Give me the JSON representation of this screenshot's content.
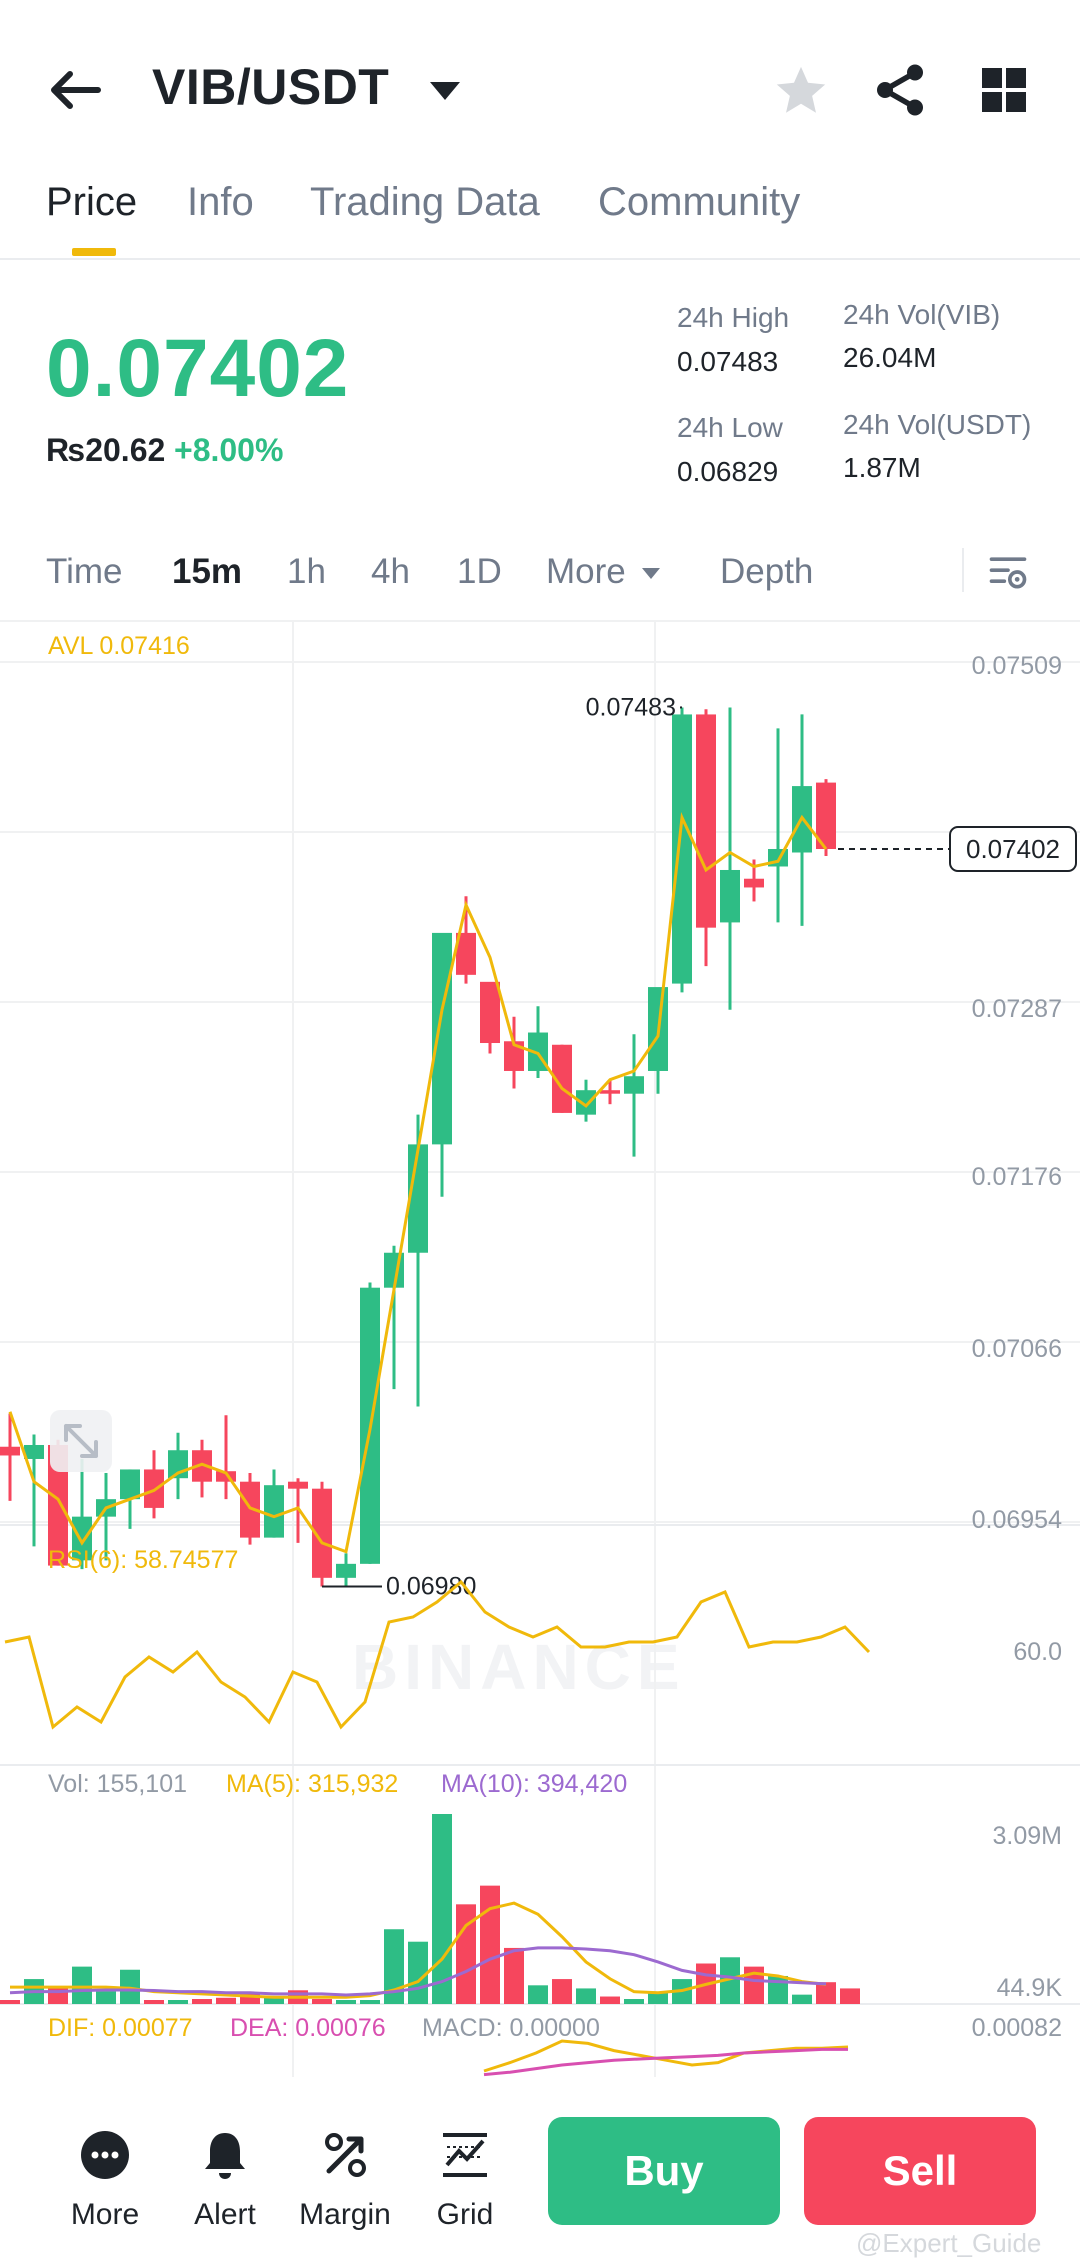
{
  "header": {
    "pair": "VIB/USDT",
    "icons": [
      "back-arrow-icon",
      "caret-down-icon",
      "star-icon",
      "share-icon",
      "grid-icon"
    ]
  },
  "tabs": [
    "Price",
    "Info",
    "Trading Data",
    "Community"
  ],
  "summary": {
    "last_price": "0.07402",
    "fiat": "₨20.62",
    "change": "+8.00%",
    "high_label": "24h High",
    "high": "0.07483",
    "low_label": "24h Low",
    "low": "0.06829",
    "vol_base_label": "24h Vol(VIB)",
    "vol_base": "26.04M",
    "vol_quote_label": "24h Vol(USDT)",
    "vol_quote": "1.87M"
  },
  "intervals": [
    "Time",
    "15m",
    "1h",
    "4h",
    "1D",
    "More",
    "Depth"
  ],
  "chart_labels": {
    "avl": "AVL 0.07416",
    "y_ticks": [
      "0.07509",
      "0.07287",
      "0.07176",
      "0.07066",
      "0.06954"
    ],
    "current_price_tag": "0.07402",
    "max_marker": "0.07483",
    "min_marker": "0.06980",
    "watermark": "BINANCE",
    "rsi_label": "RSI(6): 58.74577",
    "rsi_tick": "60.0",
    "vol_label": "Vol: 155,101",
    "ma5_label": "MA(5): 315,932",
    "ma10_label": "MA(10): 394,420",
    "vol_ticks": [
      "3.09M",
      "44.9K"
    ],
    "dif_label": "DIF: 0.00077",
    "dea_label": "DEA: 0.00076",
    "macd_label": "MACD: 0.00000",
    "macd_tick": "0.00082"
  },
  "colors": {
    "up": "#2ebd85",
    "down": "#f6465d",
    "accent": "#f0b90b",
    "ma10": "#9c6ad0",
    "dea": "#d84fb0"
  },
  "chart_data": {
    "type": "candlestick",
    "interval": "15m",
    "candles": [
      {
        "o": 0.0706,
        "h": 0.07079,
        "l": 0.07029,
        "c": 0.07055
      },
      {
        "o": 0.07053,
        "h": 0.07067,
        "l": 0.07003,
        "c": 0.07061
      },
      {
        "o": 0.07061,
        "h": 0.07064,
        "l": 0.06992,
        "c": 0.06992
      },
      {
        "o": 0.06995,
        "h": 0.07053,
        "l": 0.0699,
        "c": 0.0702
      },
      {
        "o": 0.0702,
        "h": 0.07045,
        "l": 0.06995,
        "c": 0.0703
      },
      {
        "o": 0.0703,
        "h": 0.07047,
        "l": 0.07013,
        "c": 0.07047
      },
      {
        "o": 0.07047,
        "h": 0.07058,
        "l": 0.07019,
        "c": 0.07025
      },
      {
        "o": 0.07042,
        "h": 0.07068,
        "l": 0.0703,
        "c": 0.07058
      },
      {
        "o": 0.07058,
        "h": 0.07064,
        "l": 0.07031,
        "c": 0.0704
      },
      {
        "o": 0.07046,
        "h": 0.07078,
        "l": 0.0703,
        "c": 0.0704
      },
      {
        "o": 0.0704,
        "h": 0.07045,
        "l": 0.07004,
        "c": 0.07008
      },
      {
        "o": 0.07008,
        "h": 0.07047,
        "l": 0.07008,
        "c": 0.07038
      },
      {
        "o": 0.0704,
        "h": 0.07042,
        "l": 0.07005,
        "c": 0.07036
      },
      {
        "o": 0.07036,
        "h": 0.0704,
        "l": 0.0698,
        "c": 0.06985
      },
      {
        "o": 0.06985,
        "h": 0.06999,
        "l": 0.0698,
        "c": 0.06993
      },
      {
        "o": 0.06993,
        "h": 0.07154,
        "l": 0.06993,
        "c": 0.07151
      },
      {
        "o": 0.07151,
        "h": 0.07175,
        "l": 0.07093,
        "c": 0.07171
      },
      {
        "o": 0.07171,
        "h": 0.0725,
        "l": 0.07083,
        "c": 0.07233
      },
      {
        "o": 0.07233,
        "h": 0.07352,
        "l": 0.07203,
        "c": 0.07354
      },
      {
        "o": 0.07354,
        "h": 0.07375,
        "l": 0.07325,
        "c": 0.0733
      },
      {
        "o": 0.07326,
        "h": 0.07318,
        "l": 0.07285,
        "c": 0.07291
      },
      {
        "o": 0.07292,
        "h": 0.07306,
        "l": 0.07265,
        "c": 0.07275
      },
      {
        "o": 0.07275,
        "h": 0.07312,
        "l": 0.07271,
        "c": 0.07297
      },
      {
        "o": 0.0729,
        "h": 0.0729,
        "l": 0.07251,
        "c": 0.07251
      },
      {
        "o": 0.0725,
        "h": 0.0727,
        "l": 0.07246,
        "c": 0.07264
      },
      {
        "o": 0.07264,
        "h": 0.0727,
        "l": 0.07256,
        "c": 0.07262
      },
      {
        "o": 0.07262,
        "h": 0.07296,
        "l": 0.07226,
        "c": 0.07272
      },
      {
        "o": 0.07275,
        "h": 0.07308,
        "l": 0.07262,
        "c": 0.07323
      },
      {
        "o": 0.07325,
        "h": 0.07483,
        "l": 0.0732,
        "c": 0.07479
      },
      {
        "o": 0.07479,
        "h": 0.07482,
        "l": 0.07335,
        "c": 0.07357
      },
      {
        "o": 0.0736,
        "h": 0.07483,
        "l": 0.0731,
        "c": 0.0739
      },
      {
        "o": 0.07385,
        "h": 0.07396,
        "l": 0.07372,
        "c": 0.0738
      },
      {
        "o": 0.07392,
        "h": 0.07471,
        "l": 0.0736,
        "c": 0.07402
      },
      {
        "o": 0.074,
        "h": 0.07479,
        "l": 0.07358,
        "c": 0.07438
      },
      {
        "o": 0.0744,
        "h": 0.07442,
        "l": 0.07398,
        "c": 0.07402
      }
    ],
    "avl_line": [
      0.0708,
      0.0704,
      0.0703,
      0.07005,
      0.07025,
      0.0703,
      0.07035,
      0.07045,
      0.0705,
      0.07045,
      0.07025,
      0.0702,
      0.07025,
      0.07005,
      0.07,
      0.0707,
      0.0715,
      0.0723,
      0.0731,
      0.0737,
      0.0734,
      0.0729,
      0.07285,
      0.07265,
      0.07255,
      0.0727,
      0.07275,
      0.07295,
      0.0742,
      0.0739,
      0.074,
      0.07392,
      0.07395,
      0.0742,
      0.07402
    ],
    "rsi": [
      52,
      53,
      35,
      39,
      36,
      45,
      49,
      46,
      50,
      44,
      41,
      36,
      46,
      44,
      35,
      40,
      56,
      57,
      60,
      64,
      58,
      55,
      53,
      55,
      51,
      51,
      52,
      52,
      53,
      60,
      62,
      51,
      52,
      52,
      53,
      55,
      50
    ],
    "volume": [
      5,
      40,
      25,
      60,
      20,
      55,
      6,
      4,
      8,
      10,
      18,
      12,
      22,
      8,
      6,
      5,
      120,
      100,
      305,
      160,
      190,
      90,
      30,
      40,
      25,
      12,
      8,
      20,
      40,
      65,
      75,
      60,
      45,
      15,
      35,
      25
    ],
    "ma5": [
      30,
      30,
      30,
      30,
      30,
      28,
      22,
      20,
      18,
      16,
      14,
      12,
      12,
      12,
      12,
      15,
      25,
      40,
      80,
      140,
      170,
      180,
      160,
      120,
      75,
      45,
      22,
      20,
      24,
      35,
      45,
      55,
      50,
      40,
      35
    ],
    "ma10": [
      20,
      22,
      22,
      24,
      25,
      25,
      24,
      22,
      22,
      20,
      20,
      18,
      18,
      18,
      16,
      18,
      22,
      28,
      40,
      58,
      80,
      95,
      100,
      100,
      98,
      95,
      88,
      75,
      60,
      52,
      48,
      42,
      40,
      38,
      36
    ],
    "dif": [
      5,
      12,
      20,
      30,
      28,
      22,
      18,
      14,
      10,
      12,
      20,
      22,
      24,
      24,
      25
    ],
    "dea": [
      2,
      4,
      7,
      10,
      12,
      14,
      15,
      16,
      17,
      18,
      20,
      21,
      22,
      23,
      23
    ]
  },
  "bottom_bar": {
    "more": "More",
    "alert": "Alert",
    "margin": "Margin",
    "grid": "Grid",
    "buy": "Buy",
    "sell": "Sell"
  },
  "credit": "@Expert_Guide"
}
